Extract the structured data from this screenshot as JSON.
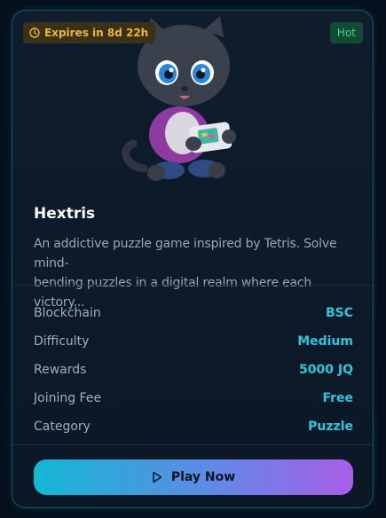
{
  "badges": {
    "expires": "Expires in 8d 22h",
    "tag": "Hot"
  },
  "game": {
    "title": "Hextris",
    "description_lines": [
      "An addictive puzzle game inspired by Tetris. Solve mind-",
      "bending puzzles in a digital realm where each victory..."
    ]
  },
  "details": [
    {
      "label": "Blockchain",
      "value": "BSC"
    },
    {
      "label": "Difficulty",
      "value": "Medium"
    },
    {
      "label": "Rewards",
      "value": "5000 JQ"
    },
    {
      "label": "Joining Fee",
      "value": "Free"
    },
    {
      "label": "Category",
      "value": "Puzzle"
    }
  ],
  "action": {
    "label": "Play Now"
  },
  "colors": {
    "accent": "#2fc6dc",
    "expires_text": "#f0b43a",
    "hot_text": "#3fd98a"
  }
}
